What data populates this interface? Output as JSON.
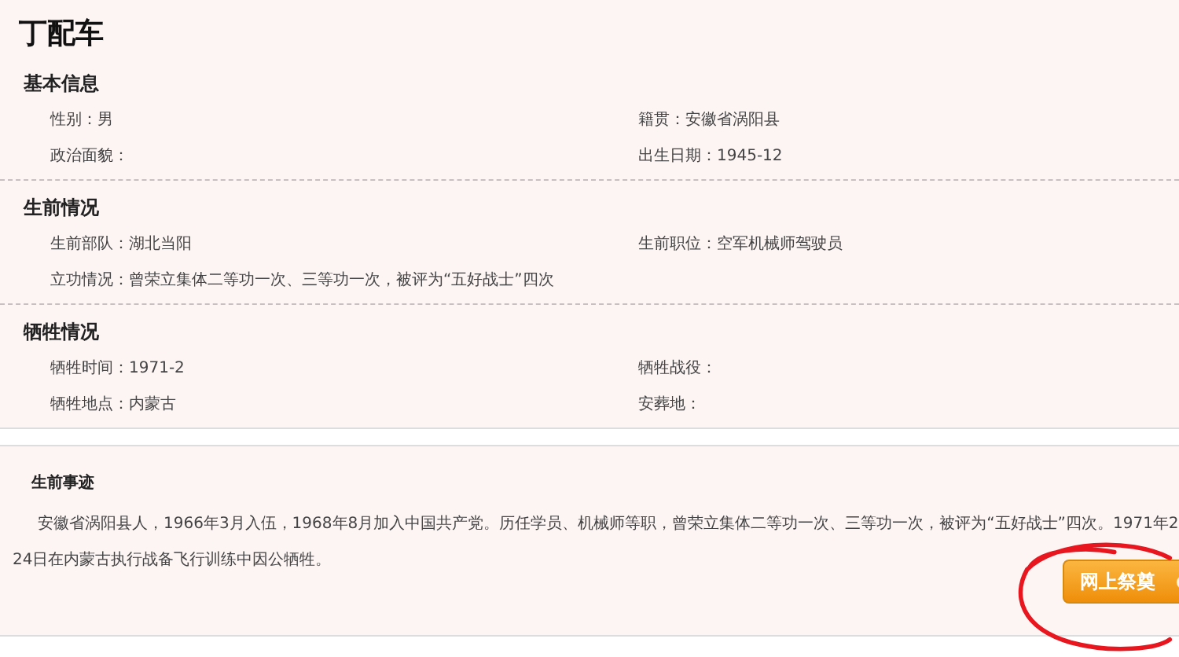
{
  "title": "丁配车",
  "sections": [
    {
      "heading": "基本信息",
      "rows": [
        [
          "性别：男",
          "籍贯：安徽省涡阳县"
        ],
        [
          "政治面貌：",
          "出生日期：1945-12"
        ]
      ]
    },
    {
      "heading": "生前情况",
      "rows": [
        [
          "生前部队：湖北当阳",
          "生前职位：空军机械师驾驶员"
        ],
        [
          "立功情况：曾荣立集体二等功一次、三等功一次，被评为“五好战士”四次"
        ]
      ]
    },
    {
      "heading": "牺牲情况",
      "rows": [
        [
          "牺牲时间：1971-2",
          "牺牲战役："
        ],
        [
          "牺牲地点：内蒙古",
          "安葬地："
        ]
      ]
    }
  ],
  "biography": {
    "heading": "生前事迹",
    "lines": [
      "安徽省涡阳县人，1966年3月入伍，1968年8月加入中国共产党。历任学员、机械师等职，曾荣立集体二等功一次、三等功一次，被评为“五好战士”四次。1971年2",
      "24日在内蒙古执行战备飞行训练中因公牺牲。"
    ]
  },
  "button": {
    "label": "网上祭奠"
  }
}
